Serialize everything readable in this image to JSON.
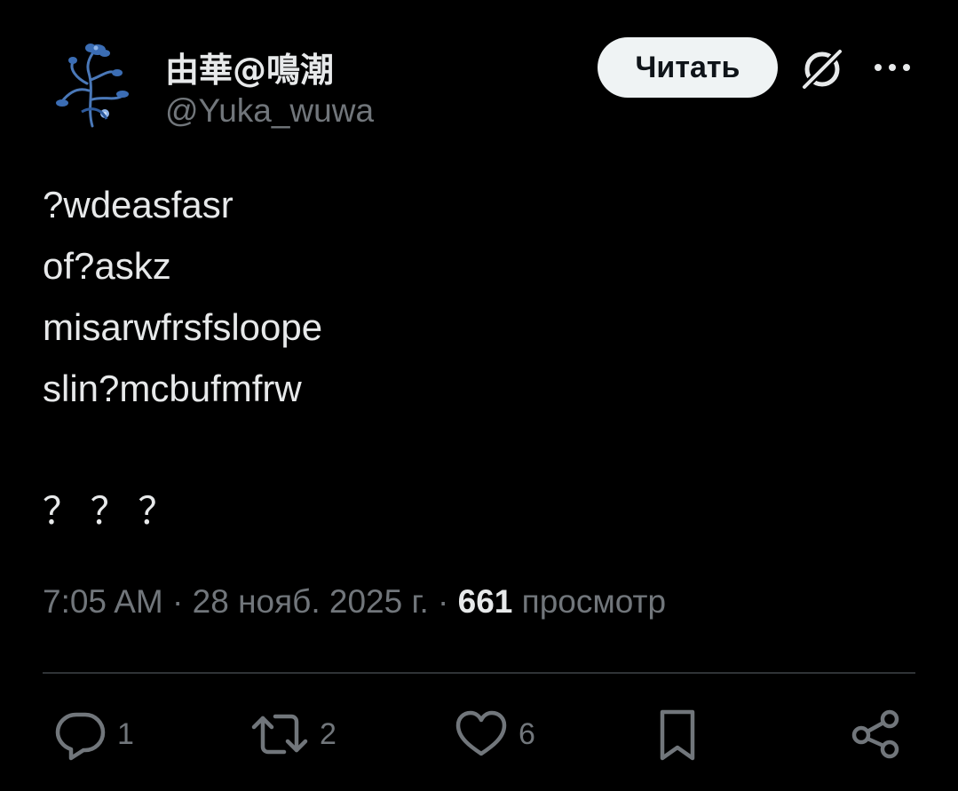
{
  "author": {
    "display_name": "由華@鳴潮",
    "handle": "@Yuka_wuwa",
    "avatar_icon": "blue-flower-avatar"
  },
  "header": {
    "follow_label": "Читать",
    "grok_icon": "grok-icon",
    "more_icon": "more-horizontal-icon"
  },
  "tweet": {
    "lines": [
      "?wdeasfasr",
      "of?askz",
      "misarwfrsfsloope",
      "slin?mcbufmfrw",
      "",
      "？ ？ ？"
    ]
  },
  "meta": {
    "time": "7:05 AM",
    "separator": " · ",
    "date": "28 нояб. 2025 г.",
    "views": "661",
    "views_label": "просмотр"
  },
  "actions": {
    "reply": {
      "icon": "reply-icon",
      "count": "1"
    },
    "retweet": {
      "icon": "retweet-icon",
      "count": "2"
    },
    "like": {
      "icon": "heart-icon",
      "count": "6"
    },
    "bookmark": {
      "icon": "bookmark-icon"
    },
    "share": {
      "icon": "share-icon"
    }
  },
  "colors": {
    "background": "#000000",
    "text": "#e7e9ea",
    "muted": "#71767b",
    "divider": "#2f3336",
    "button_bg": "#eff3f4"
  }
}
